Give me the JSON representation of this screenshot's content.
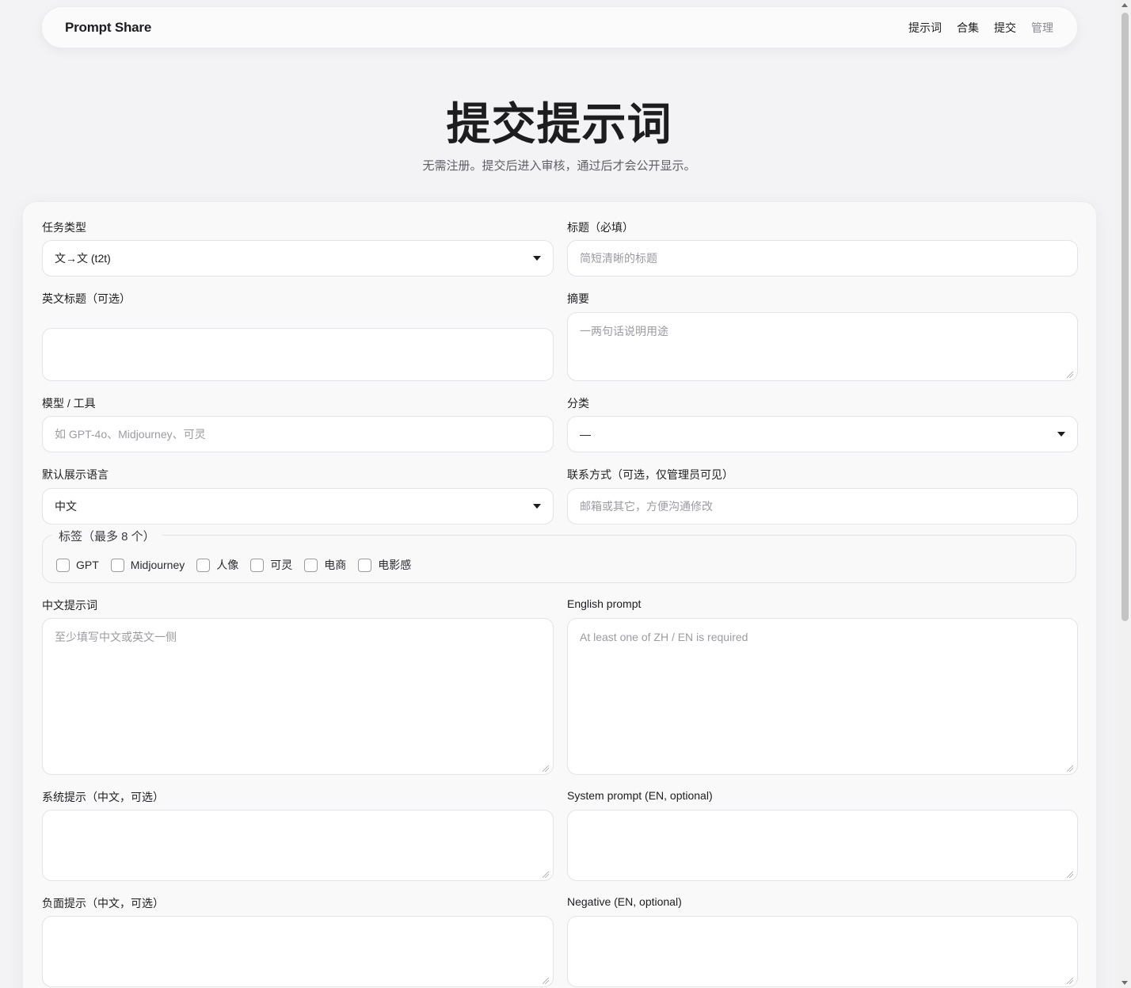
{
  "header": {
    "brand": "Prompt Share",
    "nav": [
      "提示词",
      "合集",
      "提交",
      "管理"
    ]
  },
  "hero": {
    "title": "提交提示词",
    "subtitle": "无需注册。提交后进入审核，通过后才会公开显示。"
  },
  "form": {
    "task_type": {
      "label": "任务类型",
      "value": "文→文 (t2t)"
    },
    "title": {
      "label": "标题（必填）",
      "placeholder": "简短清晰的标题"
    },
    "title_en": {
      "label": "英文标题（可选）",
      "value": ""
    },
    "summary": {
      "label": "摘要",
      "placeholder": "一两句话说明用途"
    },
    "model": {
      "label": "模型 / 工具",
      "placeholder": "如 GPT-4o、Midjourney、可灵"
    },
    "category": {
      "label": "分类",
      "value": "—"
    },
    "language": {
      "label": "默认展示语言",
      "value": "中文"
    },
    "contact": {
      "label": "联系方式（可选，仅管理员可见）",
      "placeholder": "邮箱或其它，方便沟通修改"
    },
    "tags": {
      "legend": "标签（最多 8 个）",
      "options": [
        "GPT",
        "Midjourney",
        "人像",
        "可灵",
        "电商",
        "电影感"
      ]
    },
    "prompt_zh": {
      "label": "中文提示词",
      "placeholder": "至少填写中文或英文一侧"
    },
    "prompt_en": {
      "label": "English prompt",
      "placeholder": "At least one of ZH / EN is required"
    },
    "system_zh": {
      "label": "系统提示（中文，可选）"
    },
    "system_en": {
      "label": "System prompt (EN, optional)"
    },
    "negative_zh": {
      "label": "负面提示（中文，可选）"
    },
    "negative_en": {
      "label": "Negative (EN, optional)"
    }
  }
}
